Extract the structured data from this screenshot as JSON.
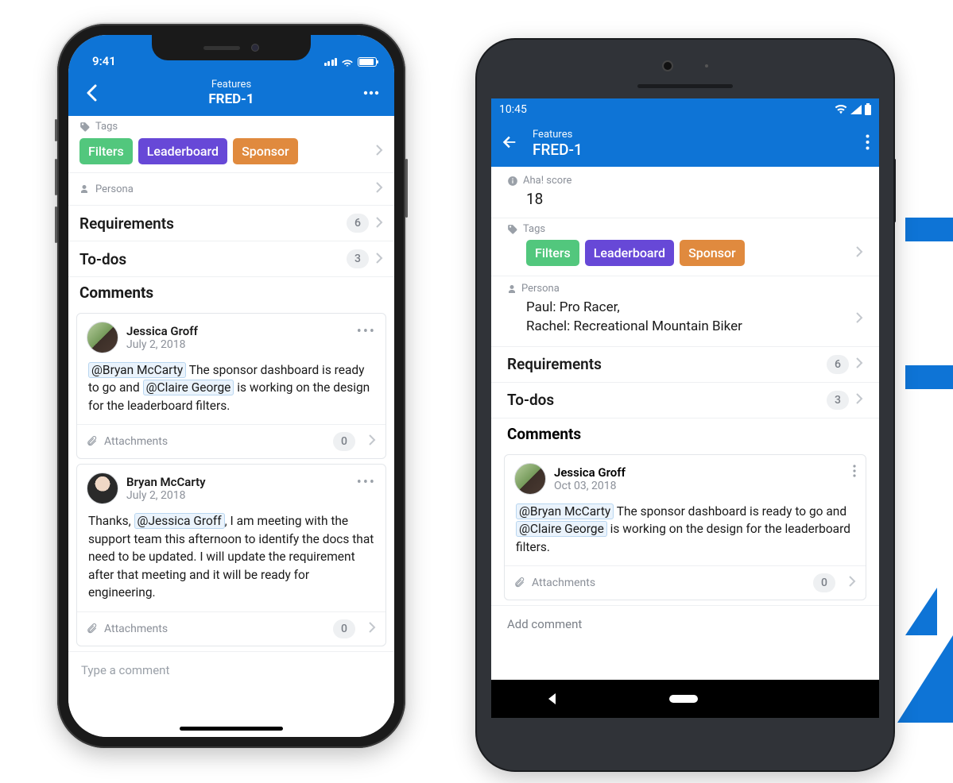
{
  "ios": {
    "status": {
      "time": "9:41"
    },
    "nav": {
      "subtitle": "Features",
      "title": "FRED-1"
    },
    "tags_label": "Tags",
    "tags": [
      "Filters",
      "Leaderboard",
      "Sponsor"
    ],
    "persona_label": "Persona",
    "rows": {
      "requirements": {
        "label": "Requirements",
        "count": "6"
      },
      "todos": {
        "label": "To-dos",
        "count": "3"
      }
    },
    "comments_header": "Comments",
    "comments": [
      {
        "author": "Jessica Groff",
        "date": "July 2, 2018",
        "mention1": "@Bryan McCarty",
        "text1": " The sponsor dashboard is ready to go and ",
        "mention2": "@Claire George",
        "text2": " is working on the design for the leaderboard filters.",
        "attachments_label": "Attachments",
        "attachments_count": "0"
      },
      {
        "author": "Bryan McCarty",
        "date": "July 2, 2018",
        "pretext": "Thanks, ",
        "mention1": "@Jessica Groff",
        "text1": ", I am meeting with the support team this afternoon to identify the docs that need to be updated. I will update the requirement after that meeting and it will be ready for engineering.",
        "attachments_label": "Attachments",
        "attachments_count": "0"
      }
    ],
    "comment_placeholder": "Type a comment"
  },
  "android": {
    "status": {
      "time": "10:45"
    },
    "nav": {
      "subtitle": "Features",
      "title": "FRED-1"
    },
    "score_label": "Aha! score",
    "score_value": "18",
    "tags_label": "Tags",
    "tags": [
      "Filters",
      "Leaderboard",
      "Sponsor"
    ],
    "persona_label": "Persona",
    "persona_value_1": "Paul: Pro Racer,",
    "persona_value_2": "Rachel: Recreational Mountain Biker",
    "rows": {
      "requirements": {
        "label": "Requirements",
        "count": "6"
      },
      "todos": {
        "label": "To-dos",
        "count": "3"
      }
    },
    "comments_header": "Comments",
    "comment": {
      "author": "Jessica Groff",
      "date": "Oct 03, 2018",
      "mention1": "@Bryan McCarty",
      "text1": " The sponsor dashboard is ready to go and ",
      "mention2": "@Claire George",
      "text2": " is working on the design for the leaderboard filters.",
      "attachments_label": "Attachments",
      "attachments_count": "0"
    },
    "comment_placeholder": "Add comment"
  }
}
